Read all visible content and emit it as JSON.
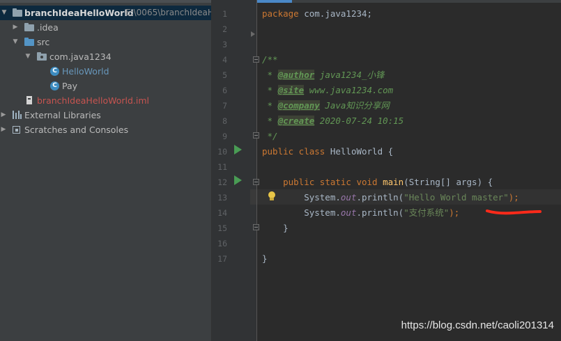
{
  "project_tree": {
    "root": {
      "name": "branchIdeaHelloWorld",
      "path": "E:\\0065\\branchIdeaH"
    },
    "items": [
      {
        "label": "branchIdeaHelloWorld",
        "path": "E:\\0065\\branchIdeaH"
      },
      {
        "label": ".idea"
      },
      {
        "label": "src"
      },
      {
        "label": "com.java1234"
      },
      {
        "label": "HelloWorld"
      },
      {
        "label": "Pay"
      },
      {
        "label": "branchIdeaHelloWorld.iml"
      },
      {
        "label": "External Libraries"
      },
      {
        "label": "Scratches and Consoles"
      }
    ],
    "class_icon_letter": "C",
    "colors": {
      "selected_row": "#0d293e",
      "class_text": "#6897bb",
      "iml_text": "#c75450"
    }
  },
  "editor": {
    "line_numbers": [
      "1",
      "2",
      "3",
      "4",
      "5",
      "6",
      "7",
      "8",
      "9",
      "10",
      "11",
      "12",
      "13",
      "14",
      "15",
      "16",
      "17"
    ],
    "current_line": "13",
    "code": {
      "l1_kw": "package",
      "l1_rest": " com.java1234;",
      "l4": "/**",
      "l5_star": " * ",
      "l5_tag": "@author",
      "l5_text": " java1234_小锋",
      "l6_star": " * ",
      "l6_tag": "@site",
      "l6_text": " www.java1234.com",
      "l7_star": " * ",
      "l7_tag": "@company",
      "l7_text": " Java知识分享网",
      "l8_star": " * ",
      "l8_tag": "@create",
      "l8_text": " 2020-07-24 10:15",
      "l9": " */",
      "l10_kw": "public class",
      "l10_rest": " HelloWorld {",
      "l12_indent": "    ",
      "l12_kw": "public static void",
      "l12_sp": " ",
      "l12_fn": "main",
      "l12_rest": "(String[] args) {",
      "l13_pre": "        System.",
      "l13_fld": "out",
      "l13_mid": ".println(",
      "l13_str": "\"Hello World master\"",
      "l13_end": ");",
      "l14_pre": "        System.",
      "l14_fld": "out",
      "l14_mid": ".println(",
      "l14_str": "\"支付系统\"",
      "l14_end": ");",
      "l16": "    }",
      "l17": "}"
    },
    "colors": {
      "keyword": "#cc7832",
      "string": "#6a8759",
      "field": "#9876aa",
      "method": "#ffc66d",
      "doc": "#629755",
      "annotation_mark": "#ff2a1a"
    }
  },
  "watermark": "https://blog.csdn.net/caoli201314"
}
